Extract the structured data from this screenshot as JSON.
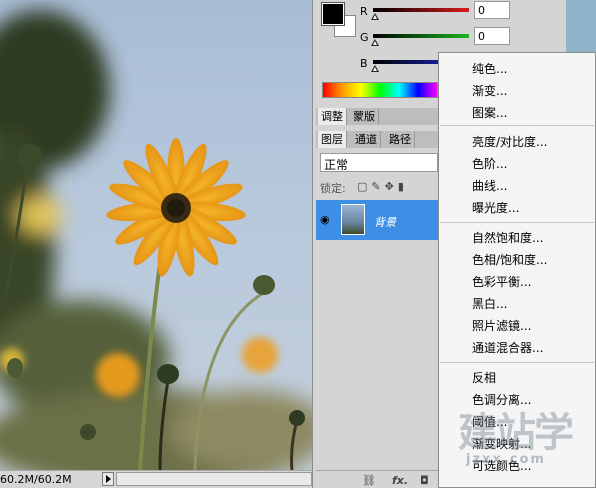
{
  "status_bar": {
    "doc_info": "60.2M/60.2M"
  },
  "color_panel": {
    "channels": [
      {
        "label": "R",
        "value": "0",
        "color": "#d81b1b"
      },
      {
        "label": "G",
        "value": "0",
        "color": "#19b51f"
      },
      {
        "label": "B",
        "value": "0",
        "color": "#1b2bd8"
      }
    ]
  },
  "adjust_tabs": [
    "调整",
    "蒙版"
  ],
  "layer_tabs": [
    "图层",
    "通道",
    "路径"
  ],
  "layers": {
    "blend_mode": "正常",
    "lock_label": "锁定:",
    "layer_name": "背景"
  },
  "menu": {
    "groups": [
      [
        "纯色...",
        "渐变...",
        "图案..."
      ],
      [
        "亮度/对比度...",
        "色阶...",
        "曲线...",
        "曝光度..."
      ],
      [
        "自然饱和度...",
        "色相/饱和度...",
        "色彩平衡...",
        "黑白...",
        "照片滤镜...",
        "通道混合器..."
      ],
      [
        "反相",
        "色调分离...",
        "阈值...",
        "渐变映射...",
        "可选颜色..."
      ]
    ]
  },
  "watermark": {
    "line1": "建站学",
    "line2": "jzxx.com"
  },
  "bottom_icons": [
    "link-icon",
    "fx-icon",
    "mask-icon"
  ],
  "colors": {
    "selection": "#3d8fe5",
    "panel": "#d4d4d4",
    "menu_bg": "#f5f5f5"
  }
}
